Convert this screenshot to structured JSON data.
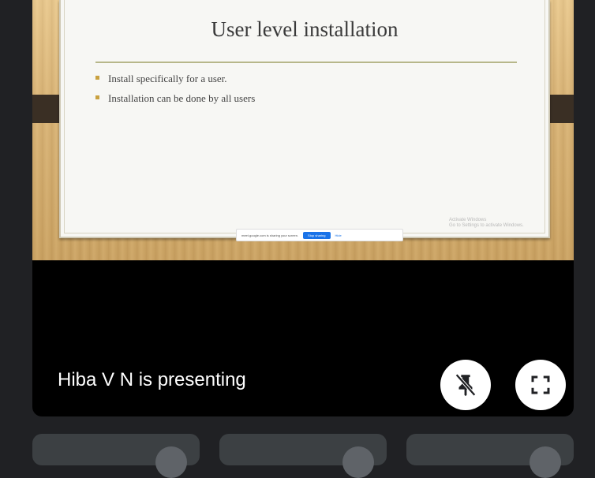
{
  "slide": {
    "title": "User level installation",
    "bullets": [
      "Install specifically for a user.",
      "Installation can be done by all users"
    ]
  },
  "share_bar": {
    "message": "meet.google.com is sharing your screen.",
    "stop_label": "Stop sharing",
    "hide_label": "Hide"
  },
  "watermark": {
    "line1": "Activate Windows",
    "line2": "Go to Settings to activate Windows."
  },
  "presenter_label": "Hiba V N is presenting",
  "controls": {
    "unpin_icon": "unpin-icon",
    "fullscreen_icon": "fullscreen-icon"
  },
  "colors": {
    "background": "#202124",
    "tile": "#000000",
    "button": "#ffffff",
    "participant_tile": "#3c4043"
  }
}
